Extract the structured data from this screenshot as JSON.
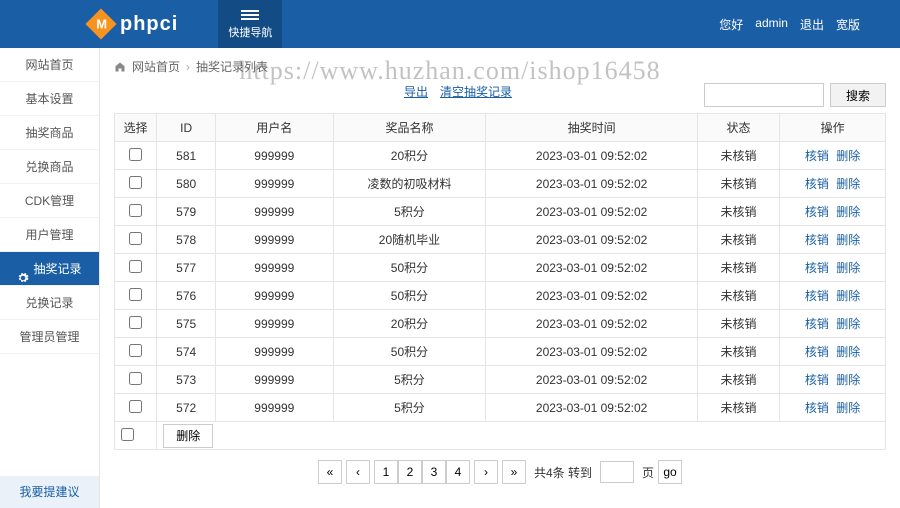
{
  "watermark": "https://www.huzhan.com/ishop16458",
  "topbar": {
    "brand": "phpci",
    "quick_nav": "快捷导航",
    "greeting": "您好",
    "user": "admin",
    "logout": "退出",
    "front": "宽版"
  },
  "sidebar": {
    "items": [
      {
        "label": "网站首页"
      },
      {
        "label": "基本设置"
      },
      {
        "label": "抽奖商品"
      },
      {
        "label": "兑换商品"
      },
      {
        "label": "CDK管理"
      },
      {
        "label": "用户管理"
      },
      {
        "label": "抽奖记录",
        "active": true
      },
      {
        "label": "兑换记录"
      },
      {
        "label": "管理员管理"
      }
    ],
    "feedback": "我要提建议"
  },
  "crumb": {
    "root": "网站首页",
    "current": "抽奖记录列表"
  },
  "toolbar": {
    "export": "导出",
    "clear": "清空抽奖记录",
    "search_label": "搜索"
  },
  "table": {
    "headers": {
      "select": "选择",
      "id": "ID",
      "user": "用户名",
      "prize": "奖品名称",
      "time": "抽奖时间",
      "status": "状态",
      "op": "操作"
    },
    "rows": [
      {
        "id": "581",
        "user": "999999",
        "prize": "20积分",
        "time": "2023-03-01 09:52:02",
        "status": "未核销"
      },
      {
        "id": "580",
        "user": "999999",
        "prize": "凌数的初吸材料",
        "time": "2023-03-01 09:52:02",
        "status": "未核销"
      },
      {
        "id": "579",
        "user": "999999",
        "prize": "5积分",
        "time": "2023-03-01 09:52:02",
        "status": "未核销"
      },
      {
        "id": "578",
        "user": "999999",
        "prize": "20随机毕业",
        "time": "2023-03-01 09:52:02",
        "status": "未核销"
      },
      {
        "id": "577",
        "user": "999999",
        "prize": "50积分",
        "time": "2023-03-01 09:52:02",
        "status": "未核销"
      },
      {
        "id": "576",
        "user": "999999",
        "prize": "50积分",
        "time": "2023-03-01 09:52:02",
        "status": "未核销"
      },
      {
        "id": "575",
        "user": "999999",
        "prize": "20积分",
        "time": "2023-03-01 09:52:02",
        "status": "未核销"
      },
      {
        "id": "574",
        "user": "999999",
        "prize": "50积分",
        "time": "2023-03-01 09:52:02",
        "status": "未核销"
      },
      {
        "id": "573",
        "user": "999999",
        "prize": "5积分",
        "time": "2023-03-01 09:52:02",
        "status": "未核销"
      },
      {
        "id": "572",
        "user": "999999",
        "prize": "5积分",
        "time": "2023-03-01 09:52:02",
        "status": "未核销"
      }
    ],
    "op_verify": "核销",
    "op_delete": "删除",
    "batch_delete": "删除"
  },
  "pager": {
    "first": "«",
    "prev": "‹",
    "pages": [
      "1",
      "2",
      "3",
      "4"
    ],
    "next": "›",
    "last": "»",
    "total_text": "共4条 转到",
    "unit": "页",
    "go": "go"
  }
}
